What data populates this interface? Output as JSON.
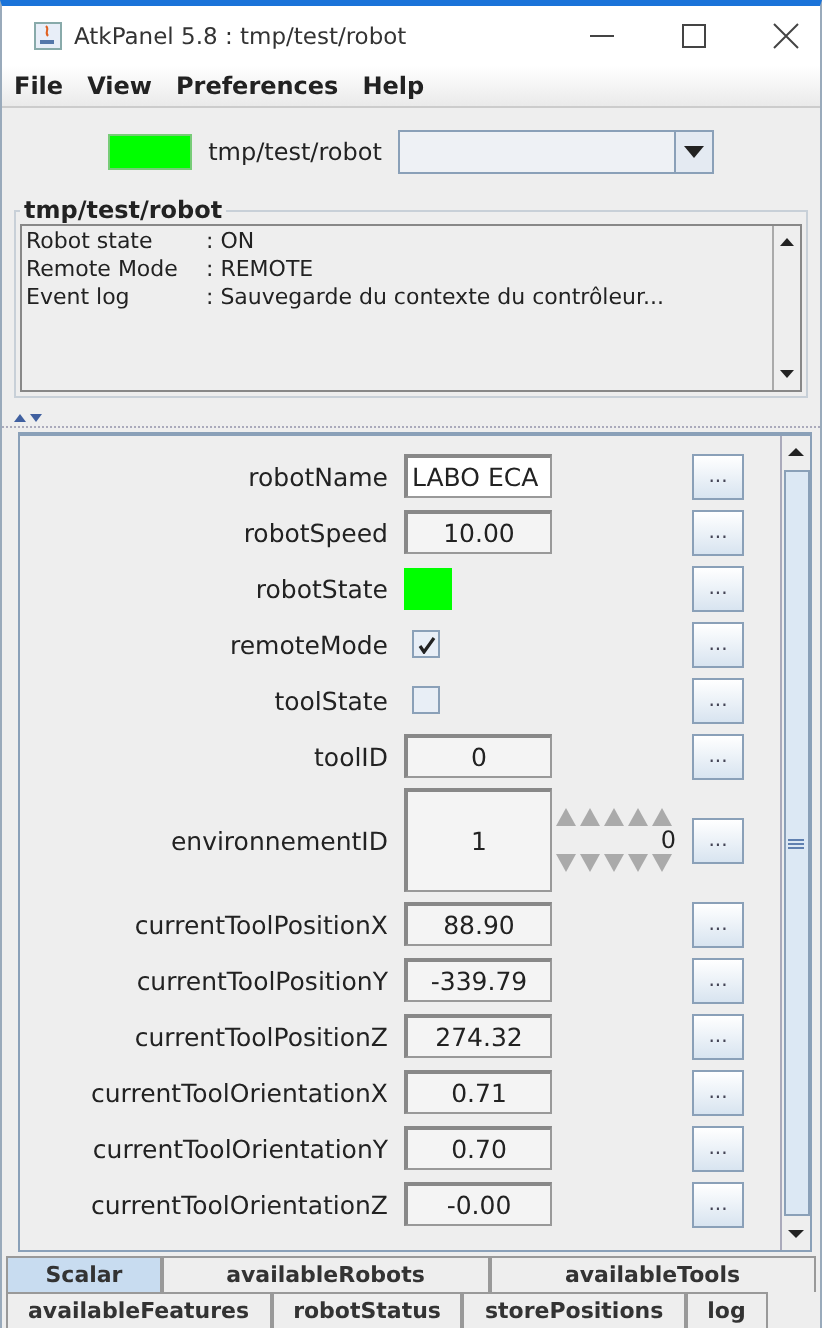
{
  "window": {
    "title": "AtkPanel 5.8 : tmp/test/robot"
  },
  "menu": [
    {
      "label": "File"
    },
    {
      "label": "View"
    },
    {
      "label": "Preferences"
    },
    {
      "label": "Help"
    }
  ],
  "device": {
    "color": "#00ff00",
    "name": "tmp/test/robot"
  },
  "status_box": {
    "title": "tmp/test/robot",
    "lines": [
      {
        "key": "Robot state",
        "value": ": ON"
      },
      {
        "key": "Remote Mode",
        "value": ": REMOTE"
      },
      {
        "key": "Event log",
        "value": ": Sauvegarde du contexte du contrôleur..."
      }
    ]
  },
  "attributes": [
    {
      "kind": "text",
      "label": "robotName",
      "value": "LABO ECA",
      "button": "..."
    },
    {
      "kind": "number",
      "label": "robotSpeed",
      "value": "10.00",
      "button": "..."
    },
    {
      "kind": "state",
      "label": "robotState",
      "color": "#00ff00",
      "button": "..."
    },
    {
      "kind": "boolean",
      "label": "remoteMode",
      "checked": true,
      "button": "..."
    },
    {
      "kind": "boolean",
      "label": "toolState",
      "checked": false,
      "button": "..."
    },
    {
      "kind": "number",
      "label": "toolID",
      "value": "0",
      "button": "..."
    },
    {
      "kind": "spin",
      "label": "environnementID",
      "value": "1",
      "spin_value": "0",
      "button": "..."
    },
    {
      "kind": "number",
      "label": "currentToolPositionX",
      "value": "88.90",
      "button": "..."
    },
    {
      "kind": "number",
      "label": "currentToolPositionY",
      "value": "-339.79",
      "button": "..."
    },
    {
      "kind": "number",
      "label": "currentToolPositionZ",
      "value": "274.32",
      "button": "..."
    },
    {
      "kind": "number",
      "label": "currentToolOrientationX",
      "value": "0.71",
      "button": "..."
    },
    {
      "kind": "number",
      "label": "currentToolOrientationY",
      "value": "0.70",
      "button": "..."
    },
    {
      "kind": "number",
      "label": "currentToolOrientationZ",
      "value": "-0.00",
      "button": "..."
    }
  ],
  "tab_rows": [
    {
      "tabs": [
        {
          "label": "Scalar",
          "selected": true
        },
        {
          "label": "availableRobots",
          "selected": false
        },
        {
          "label": "availableTools",
          "selected": false
        }
      ]
    },
    {
      "tabs": [
        {
          "label": "availableFeatures",
          "selected": false
        },
        {
          "label": "robotStatus",
          "selected": false
        },
        {
          "label": "storePositions",
          "selected": false
        },
        {
          "label": "log",
          "selected": false
        }
      ]
    }
  ]
}
